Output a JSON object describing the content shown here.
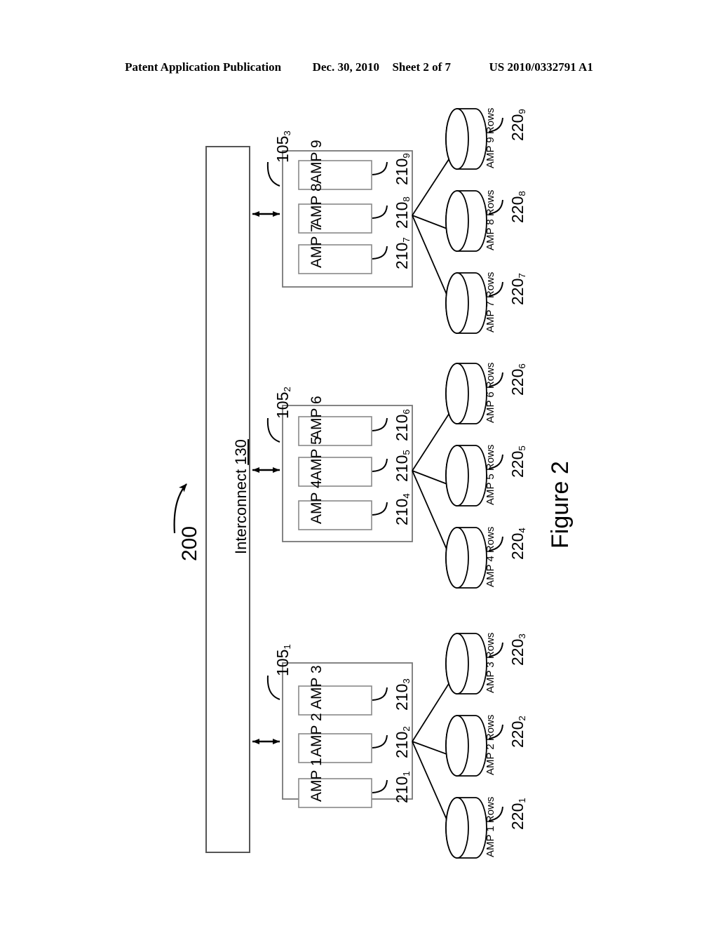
{
  "header": {
    "publication": "Patent Application Publication",
    "date": "Dec. 30, 2010",
    "sheet": "Sheet 2 of 7",
    "number": "US 2010/0332791 A1"
  },
  "figure": {
    "title": "Figure 2",
    "system_ref": "200",
    "interconnect": {
      "name": "Interconnect",
      "ref": "130",
      "label": "Interconnect 130"
    },
    "colors": {
      "line": "#000000",
      "background": "#ffffff",
      "box_stroke": "#555555"
    },
    "clusters": [
      {
        "ref": "105",
        "ref_sub": "1",
        "ref_label": "105₁",
        "amps": [
          {
            "label": "AMP 1",
            "ref": "210",
            "ref_sub": "1",
            "ref_label": "210₁"
          },
          {
            "label": "AMP 2",
            "ref": "210",
            "ref_sub": "2",
            "ref_label": "210₂"
          },
          {
            "label": "AMP 3",
            "ref": "210",
            "ref_sub": "3",
            "ref_label": "210₃"
          }
        ],
        "stores": [
          {
            "label": "AMP 1 Rows",
            "ref": "220",
            "ref_sub": "1",
            "ref_label": "220₁"
          },
          {
            "label": "AMP 2 Rows",
            "ref": "220",
            "ref_sub": "2",
            "ref_label": "220₂"
          },
          {
            "label": "AMP 3 Rows",
            "ref": "220",
            "ref_sub": "3",
            "ref_label": "220₃"
          }
        ]
      },
      {
        "ref": "105",
        "ref_sub": "2",
        "ref_label": "105₂",
        "amps": [
          {
            "label": "AMP 4",
            "ref": "210",
            "ref_sub": "4",
            "ref_label": "210₄"
          },
          {
            "label": "AMP 5",
            "ref": "210",
            "ref_sub": "5",
            "ref_label": "210₅"
          },
          {
            "label": "AMP 6",
            "ref": "210",
            "ref_sub": "6",
            "ref_label": "210₆"
          }
        ],
        "stores": [
          {
            "label": "AMP 4 Rows",
            "ref": "220",
            "ref_sub": "4",
            "ref_label": "220₄"
          },
          {
            "label": "AMP 5 Rows",
            "ref": "220",
            "ref_sub": "5",
            "ref_label": "220₅"
          },
          {
            "label": "AMP 6 Rows",
            "ref": "220",
            "ref_sub": "6",
            "ref_label": "220₆"
          }
        ]
      },
      {
        "ref": "105",
        "ref_sub": "3",
        "ref_label": "105₃",
        "amps": [
          {
            "label": "AMP 7",
            "ref": "210",
            "ref_sub": "7",
            "ref_label": "210₇"
          },
          {
            "label": "AMP 8",
            "ref": "210",
            "ref_sub": "8",
            "ref_label": "210₈"
          },
          {
            "label": "AMP 9",
            "ref": "210",
            "ref_sub": "9",
            "ref_label": "210₉"
          }
        ],
        "stores": [
          {
            "label": "AMP 7 Rows",
            "ref": "220",
            "ref_sub": "7",
            "ref_label": "220₇"
          },
          {
            "label": "AMP 8 Rows",
            "ref": "220",
            "ref_sub": "8",
            "ref_label": "220₈"
          },
          {
            "label": "AMP 9 Rows",
            "ref": "220",
            "ref_sub": "9",
            "ref_label": "220₉"
          }
        ]
      }
    ]
  }
}
